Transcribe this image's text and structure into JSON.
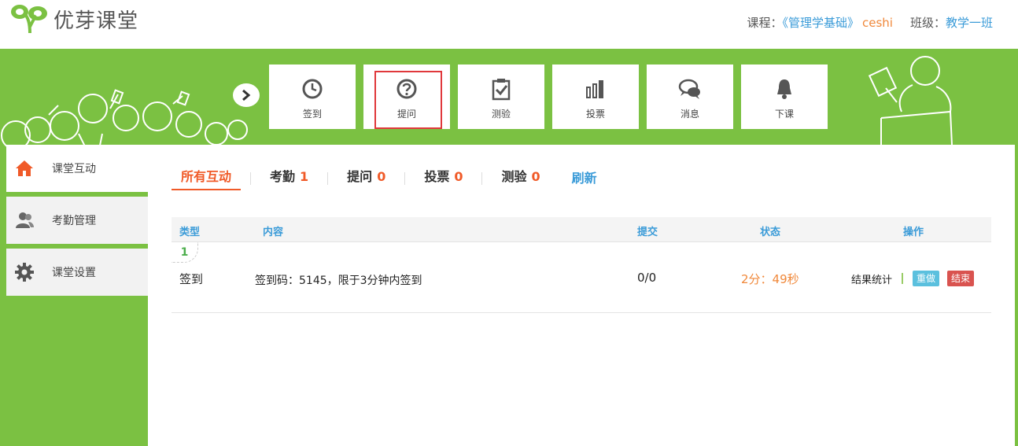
{
  "header": {
    "logo_text": "优芽课堂",
    "course_label": "课程：",
    "course_name": "《管理学基础》",
    "teacher": "ceshi",
    "class_label": "班级：",
    "class_name": "教学一班"
  },
  "toolbar": {
    "buttons": [
      {
        "label": "签到",
        "icon": "clock-icon"
      },
      {
        "label": "提问",
        "icon": "question-icon"
      },
      {
        "label": "测验",
        "icon": "clipboard-check-icon"
      },
      {
        "label": "投票",
        "icon": "bar-chart-icon"
      },
      {
        "label": "消息",
        "icon": "chat-bubbles-icon"
      },
      {
        "label": "下课",
        "icon": "bell-icon"
      }
    ]
  },
  "sidebar": {
    "items": [
      {
        "label": "课堂互动",
        "icon": "home-icon",
        "active": true
      },
      {
        "label": "考勤管理",
        "icon": "users-icon",
        "active": false
      },
      {
        "label": "课堂设置",
        "icon": "gear-icon",
        "active": false
      }
    ]
  },
  "tabs": {
    "all": "所有互动",
    "attendance": {
      "label": "考勤",
      "count": "1"
    },
    "question": {
      "label": "提问",
      "count": "0"
    },
    "vote": {
      "label": "投票",
      "count": "0"
    },
    "quiz": {
      "label": "测验",
      "count": "0"
    },
    "refresh": "刷新"
  },
  "table": {
    "headers": {
      "type": "类型",
      "content": "内容",
      "submit": "提交",
      "status": "状态",
      "ops": "操作"
    },
    "rows": [
      {
        "index": "1",
        "type": "签到",
        "content": "签到码：5145，限于3分钟内签到",
        "submit": "0/0",
        "status": "2分：49秒",
        "stats": "结果统计",
        "redo": "重做",
        "end": "结束"
      }
    ]
  },
  "colors": {
    "brand_green": "#7bc142",
    "accent_orange": "#f05a28",
    "link_blue": "#3a9bd8",
    "highlight_red": "#e0383b"
  }
}
